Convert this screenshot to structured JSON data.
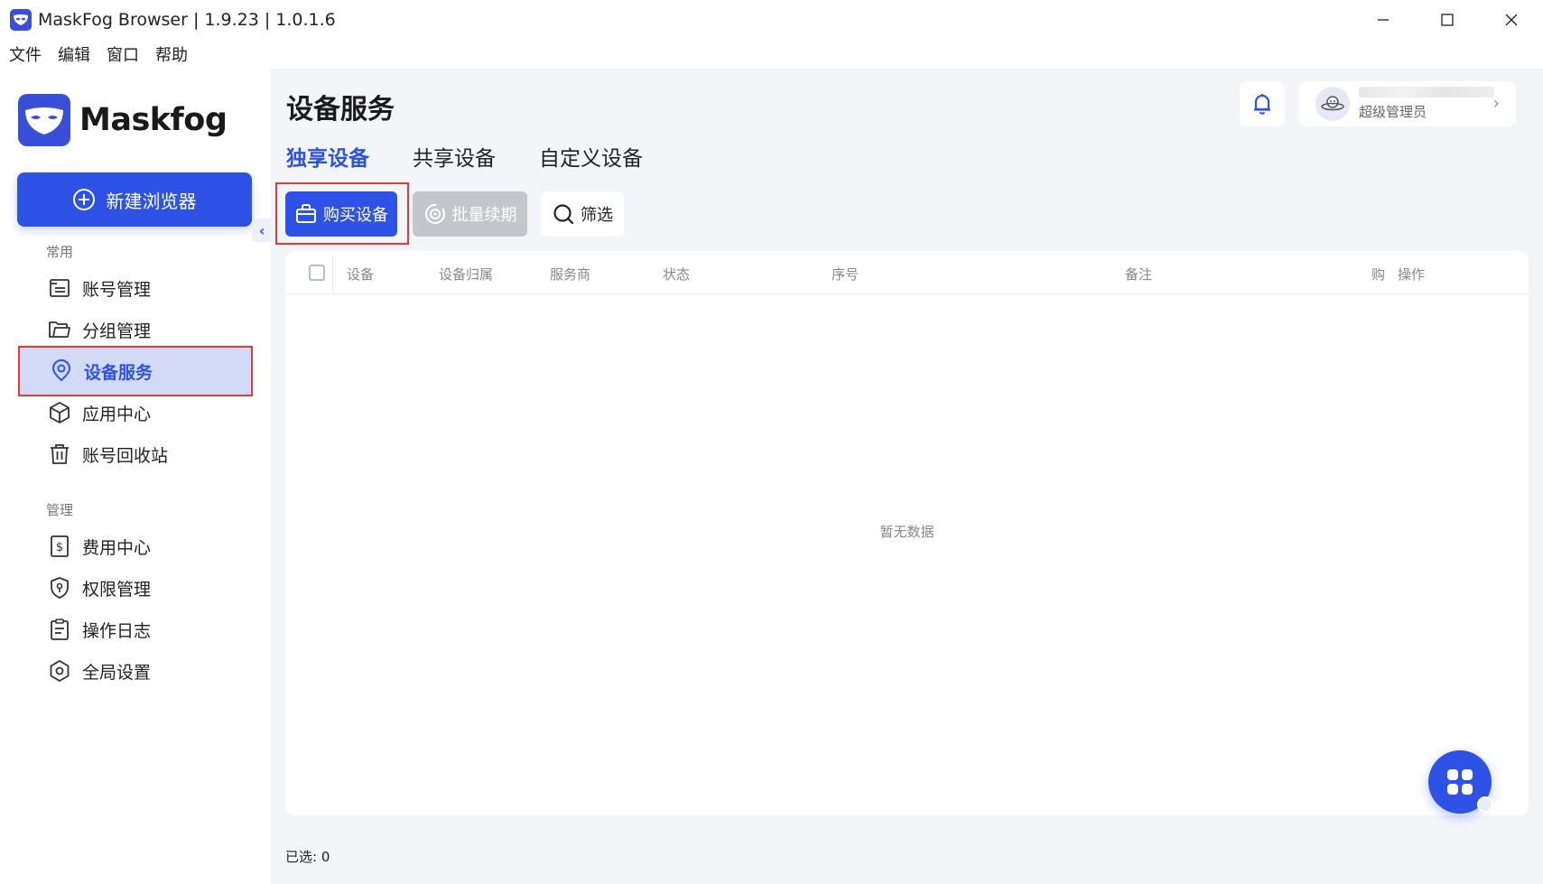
{
  "window": {
    "title": "MaskFog Browser | 1.9.23 | 1.0.1.6",
    "controls": [
      "minimize-icon",
      "maximize-icon",
      "close-icon"
    ]
  },
  "menu": {
    "items": [
      {
        "label": "文件"
      },
      {
        "label": "编辑"
      },
      {
        "label": "窗口"
      },
      {
        "label": "帮助"
      }
    ]
  },
  "sidebar": {
    "logo_text": "Maskfog",
    "new_button_label": "新建浏览器",
    "sections": [
      {
        "label": "常用",
        "items": [
          {
            "label": "账号管理",
            "icon": "account-icon"
          },
          {
            "label": "分组管理",
            "icon": "folder-icon"
          },
          {
            "label": "设备服务",
            "icon": "location-pin-icon",
            "active": true
          },
          {
            "label": "应用中心",
            "icon": "cube-icon"
          },
          {
            "label": "账号回收站",
            "icon": "trash-icon"
          }
        ]
      },
      {
        "label": "管理",
        "items": [
          {
            "label": "费用中心",
            "icon": "billing-icon"
          },
          {
            "label": "权限管理",
            "icon": "shield-icon"
          },
          {
            "label": "操作日志",
            "icon": "clipboard-icon"
          },
          {
            "label": "全局设置",
            "icon": "settings-icon"
          }
        ]
      }
    ]
  },
  "header": {
    "title": "设备服务",
    "user_role": "超级管理员"
  },
  "tabs": [
    {
      "label": "独享设备",
      "active": true
    },
    {
      "label": "共享设备"
    },
    {
      "label": "自定义设备"
    }
  ],
  "toolbar": {
    "buy_label": "购买设备",
    "renew_label": "批量续期",
    "filter_label": "筛选"
  },
  "table": {
    "columns": [
      "设备",
      "设备归属",
      "服务商",
      "状态",
      "序号",
      "备注",
      "购",
      "操作"
    ],
    "empty_text": "暂无数据"
  },
  "footer": {
    "selected_label": "已选: 0"
  },
  "colors": {
    "accent": "#2f52e6",
    "highlight_outline": "#e53935",
    "active_nav_bg": "#d3daf8"
  }
}
